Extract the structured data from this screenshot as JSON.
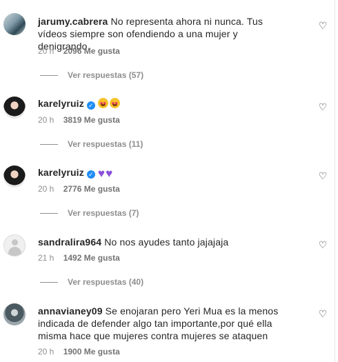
{
  "comments": [
    {
      "username": "jarumy.cabrera",
      "text": "No representa ahora ni nunca. Tus vídeos siempre son ofendiendo a una mujer y denigrando.",
      "time": "20 h",
      "likes": "2096 Me gusta",
      "replies": "Ver respuestas (57)",
      "verified": false,
      "avatar_icon": "profile-photo"
    },
    {
      "username": "karelyruiz",
      "text": "",
      "emojis": [
        "star-struck-emoji",
        "star-struck-emoji"
      ],
      "time": "20 h",
      "likes": "3819 Me gusta",
      "replies": "Ver respuestas (11)",
      "verified": true,
      "avatar_icon": "profile-photo"
    },
    {
      "username": "karelyruiz",
      "text": "",
      "emojis": [
        "purple-heart-emoji",
        "purple-heart-emoji"
      ],
      "time": "20 h",
      "likes": "2776 Me gusta",
      "replies": "Ver respuestas (7)",
      "verified": true,
      "avatar_icon": "profile-photo"
    },
    {
      "username": "sandralira964",
      "text": "No nos ayudes tanto jajajaja",
      "time": "21 h",
      "likes": "1492 Me gusta",
      "replies": "Ver respuestas (40)",
      "verified": false,
      "avatar_icon": "default-avatar"
    },
    {
      "username": "annavianey09",
      "text": "Se enojaran pero Yeri Mua es la menos indicada de defender algo tan importante,por qué ella misma hace que mujeres contra mujeres se ataquen",
      "time": "20 h",
      "likes": "1900 Me gusta",
      "verified": false,
      "avatar_icon": "profile-photo"
    }
  ],
  "icons": {
    "like": "heart-outline-icon",
    "verified": "verified-badge-icon"
  },
  "colors": {
    "text": "#262626",
    "secondary": "#8e8e8e",
    "verified": "#1f8df5",
    "purple_heart": "#8a4fd8"
  }
}
